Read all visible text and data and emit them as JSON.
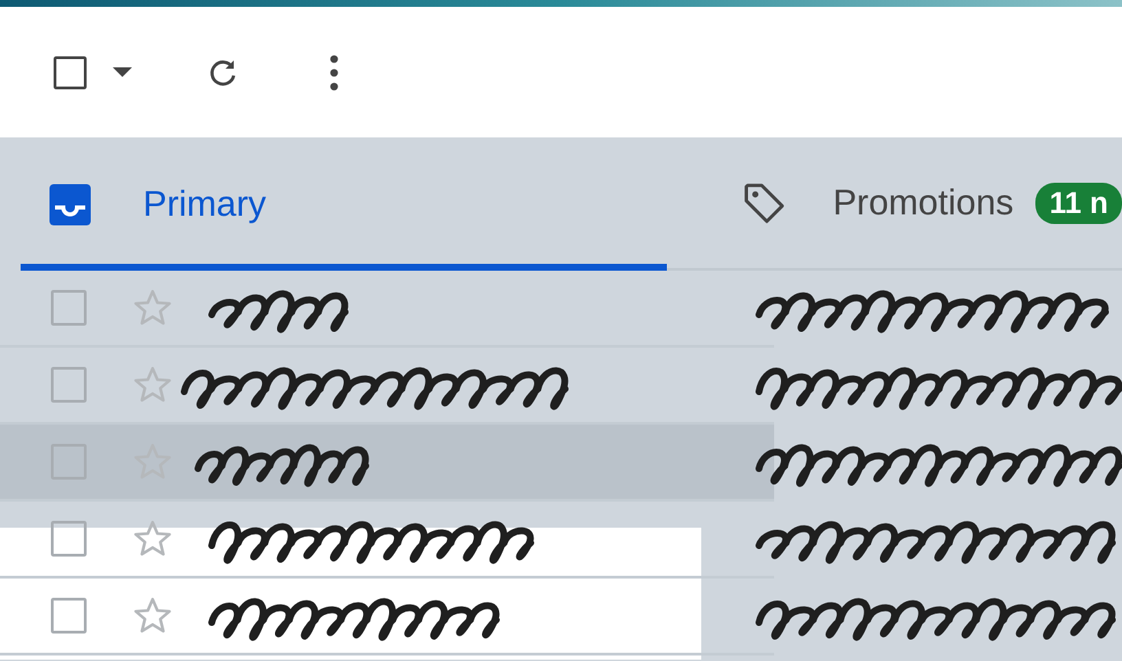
{
  "toolbar": {
    "select_all_checked": false
  },
  "tabs": [
    {
      "label": "Primary",
      "kind": "inbox",
      "selected": true
    },
    {
      "label": "Promotions",
      "kind": "tag",
      "selected": false,
      "badge": "11 n"
    }
  ],
  "rows": [
    {
      "checked": false,
      "starred": false,
      "highlighted": false
    },
    {
      "checked": false,
      "starred": false,
      "highlighted": false
    },
    {
      "checked": false,
      "starred": false,
      "highlighted": true
    },
    {
      "checked": false,
      "starred": false,
      "highlighted": false
    },
    {
      "checked": false,
      "starred": false,
      "highlighted": false
    }
  ]
}
